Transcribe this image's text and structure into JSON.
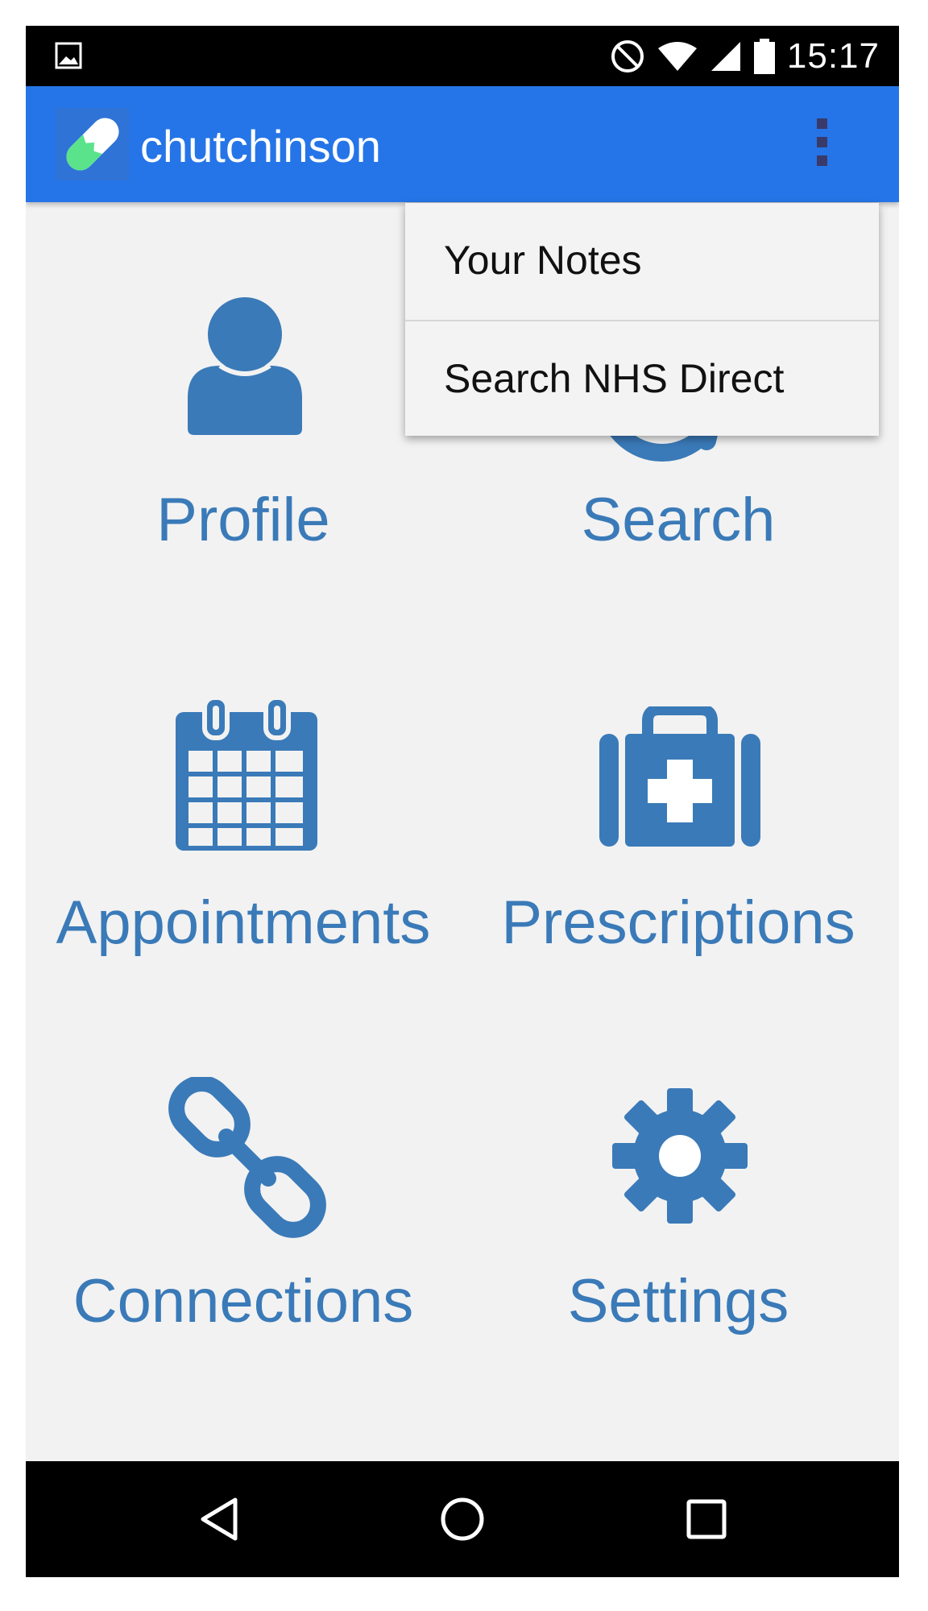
{
  "status_bar": {
    "time": "15:17",
    "icons": [
      "image-icon",
      "do-not-disturb-icon",
      "wifi-icon",
      "cell-signal-icon",
      "battery-icon"
    ]
  },
  "app_bar": {
    "title": "chutchinson",
    "logo": "pill-logo-icon",
    "overflow": "overflow-menu-icon",
    "color": "#2575e8"
  },
  "menu": {
    "items": [
      {
        "label": "Your Notes"
      },
      {
        "label": "Search NHS Direct"
      }
    ]
  },
  "grid": {
    "accent": "#3a7ab8",
    "tiles": [
      {
        "label": "Profile",
        "icon": "user-icon"
      },
      {
        "label": "Search",
        "icon": "search-icon"
      },
      {
        "label": "Appointments",
        "icon": "calendar-icon"
      },
      {
        "label": "Prescriptions",
        "icon": "medical-kit-icon"
      },
      {
        "label": "Connections",
        "icon": "link-icon"
      },
      {
        "label": "Settings",
        "icon": "gear-icon"
      }
    ]
  },
  "nav_bar": {
    "buttons": [
      "back-icon",
      "home-icon",
      "recents-icon"
    ]
  }
}
